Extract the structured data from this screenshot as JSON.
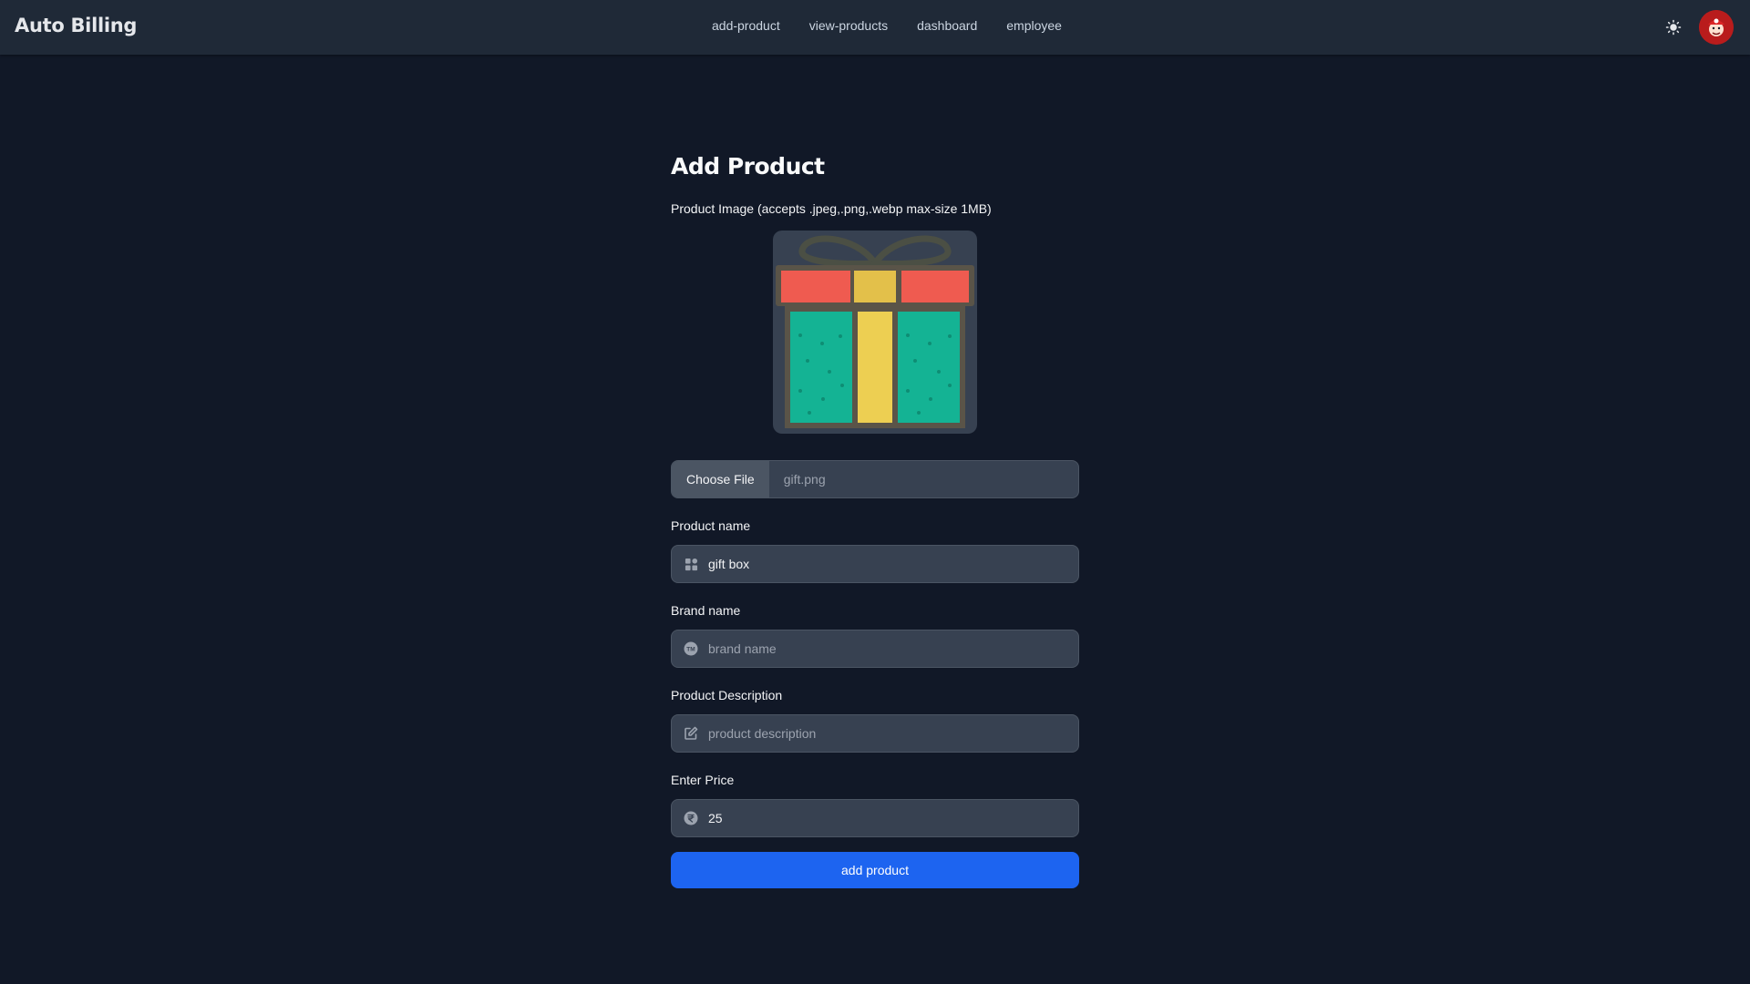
{
  "app": {
    "brand": "Auto Billing"
  },
  "nav": {
    "links": [
      "add-product",
      "view-products",
      "dashboard",
      "employee"
    ]
  },
  "colors": {
    "background": "#111827",
    "navbar": "#1f2937",
    "input_bg": "#374151",
    "accent": "#1d64f0"
  },
  "form": {
    "title": "Add Product",
    "image_label": "Product Image (accepts .jpeg,.png,.webp max-size 1MB)",
    "file": {
      "button_label": "Choose File",
      "file_name": "gift.png"
    },
    "product_name": {
      "label": "Product name",
      "value": "gift box",
      "icon": "grid-icon"
    },
    "brand_name": {
      "label": "Brand name",
      "placeholder": "brand name",
      "value": "",
      "icon": "trademark-icon"
    },
    "description": {
      "label": "Product Description",
      "placeholder": "product description",
      "value": "",
      "icon": "edit-icon"
    },
    "price": {
      "label": "Enter Price",
      "value": "25",
      "icon": "rupee-icon"
    },
    "submit_label": "add product"
  }
}
